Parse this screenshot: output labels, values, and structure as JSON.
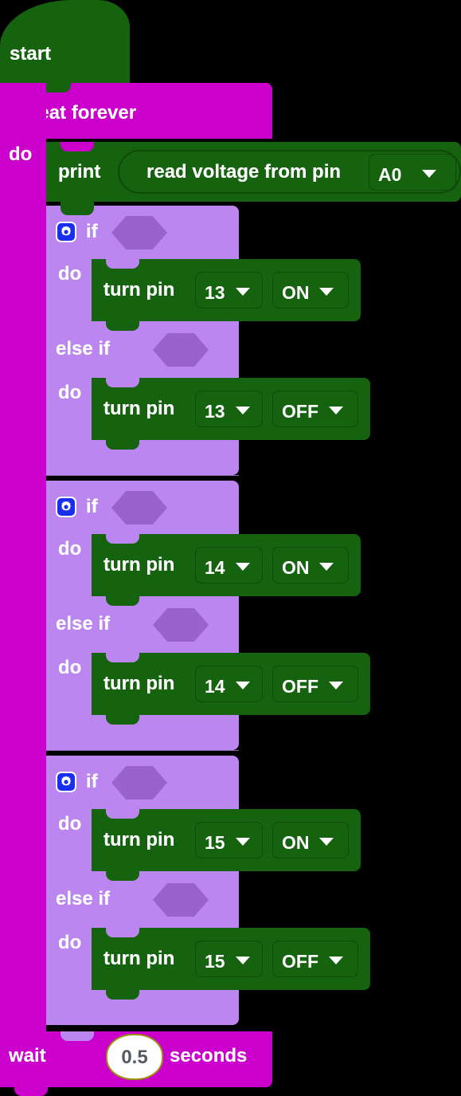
{
  "colors": {
    "background": "#000000",
    "event_block": "#15630f",
    "loop_block": "#cc00cc",
    "logic_block": "#bb86f0",
    "hex_socket": "#9a63cc",
    "mutator_icon": "#1a2ef0",
    "number_field_bg": "#ffffff",
    "number_field_text": "#555a63",
    "number_field_border": "#9a9210"
  },
  "program": {
    "start_block": {
      "label": "start"
    },
    "repeat_block": {
      "label": "repeat forever",
      "do_label": "do"
    },
    "print_block": {
      "label": "print",
      "value_block": {
        "label": "read voltage from pin",
        "pin_dropdown": {
          "value": "A0",
          "icon": "chevron-down-icon"
        }
      }
    },
    "if_blocks": [
      {
        "mutator_icon": "gear-icon",
        "if_label": "if",
        "if_condition": "",
        "do_label": "do",
        "do_statement": {
          "label": "turn pin",
          "pin_dropdown": {
            "value": "13",
            "icon": "chevron-down-icon"
          },
          "state_dropdown": {
            "value": "ON",
            "icon": "chevron-down-icon"
          }
        },
        "elseif_label": "else if",
        "elseif_condition": "",
        "elseif_do_label": "do",
        "elseif_statement": {
          "label": "turn pin",
          "pin_dropdown": {
            "value": "13",
            "icon": "chevron-down-icon"
          },
          "state_dropdown": {
            "value": "OFF",
            "icon": "chevron-down-icon"
          }
        }
      },
      {
        "mutator_icon": "gear-icon",
        "if_label": "if",
        "if_condition": "",
        "do_label": "do",
        "do_statement": {
          "label": "turn pin",
          "pin_dropdown": {
            "value": "14",
            "icon": "chevron-down-icon"
          },
          "state_dropdown": {
            "value": "ON",
            "icon": "chevron-down-icon"
          }
        },
        "elseif_label": "else if",
        "elseif_condition": "",
        "elseif_do_label": "do",
        "elseif_statement": {
          "label": "turn pin",
          "pin_dropdown": {
            "value": "14",
            "icon": "chevron-down-icon"
          },
          "state_dropdown": {
            "value": "OFF",
            "icon": "chevron-down-icon"
          }
        }
      },
      {
        "mutator_icon": "gear-icon",
        "if_label": "if",
        "if_condition": "",
        "do_label": "do",
        "do_statement": {
          "label": "turn pin",
          "pin_dropdown": {
            "value": "15",
            "icon": "chevron-down-icon"
          },
          "state_dropdown": {
            "value": "ON",
            "icon": "chevron-down-icon"
          }
        },
        "elseif_label": "else if",
        "elseif_condition": "",
        "elseif_do_label": "do",
        "elseif_statement": {
          "label": "turn pin",
          "pin_dropdown": {
            "value": "15",
            "icon": "chevron-down-icon"
          },
          "state_dropdown": {
            "value": "OFF",
            "icon": "chevron-down-icon"
          }
        }
      }
    ],
    "wait_block": {
      "label": "wait",
      "value": "0.5",
      "units_label": "seconds"
    }
  }
}
